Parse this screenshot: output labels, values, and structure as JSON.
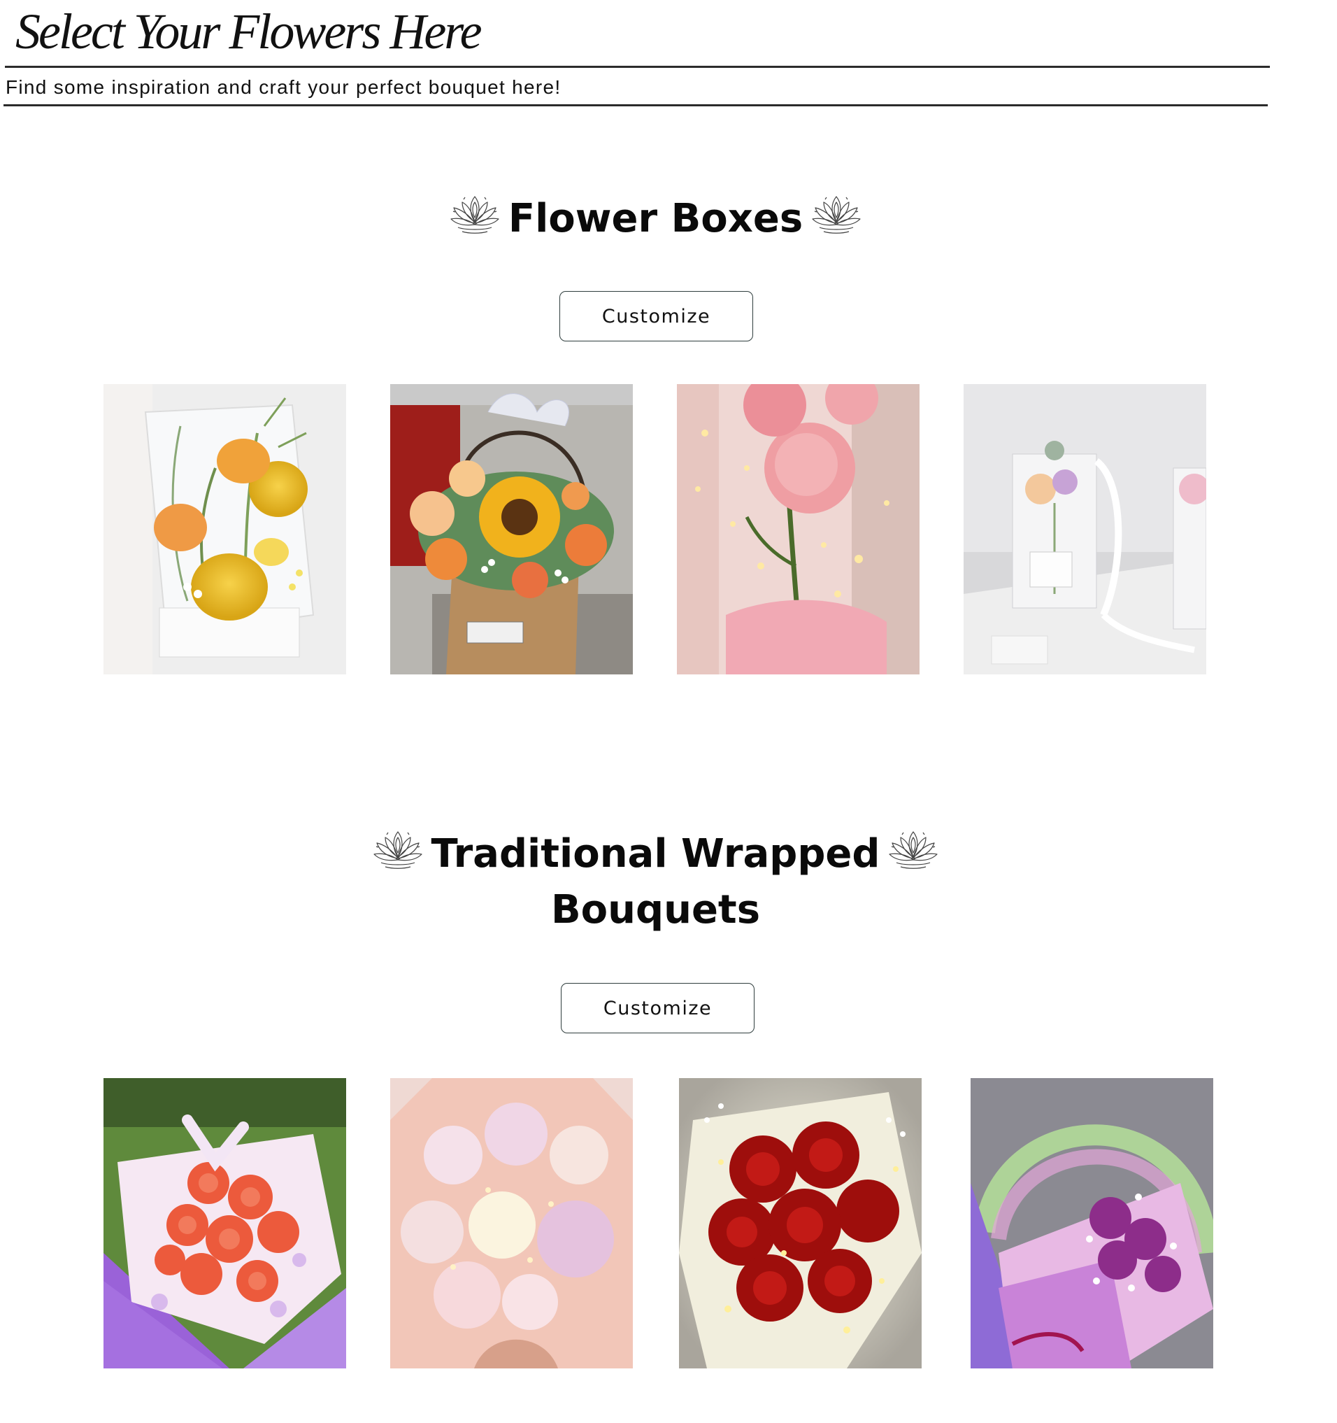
{
  "header": {
    "title": "Select Your Flowers Here",
    "subtitle": "Find some inspiration and craft your perfect bouquet here!"
  },
  "sections": [
    {
      "heading": "Flower Boxes",
      "button_label": "Customize",
      "photos": [
        "yellow-roses-clear-box-photo",
        "sunflower-kraft-bag-photo",
        "pink-carnation-light-box-photo",
        "white-gift-bags-photo"
      ]
    },
    {
      "heading_line1": "Traditional Wrapped",
      "heading_line2": "Bouquets",
      "button_label": "Customize",
      "photos": [
        "orange-roses-purple-wrap-photo",
        "pastel-peony-bouquet-photo",
        "red-roses-fairy-lights-photo",
        "purple-roses-rainbow-light-photo"
      ]
    }
  ],
  "icons": {
    "section_ornament": "lotus-icon"
  },
  "colors": {
    "text": "#111111",
    "rule": "#2b2b2b",
    "button_border": "#2f3d3d",
    "background": "#ffffff"
  }
}
